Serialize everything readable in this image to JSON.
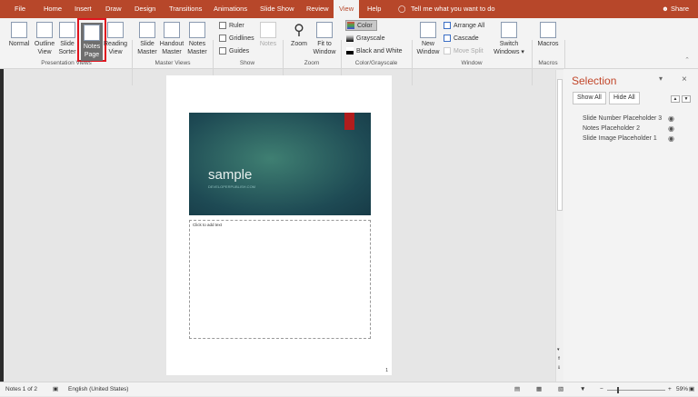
{
  "tabs": [
    "File",
    "Home",
    "Insert",
    "Draw",
    "Design",
    "Transitions",
    "Animations",
    "Slide Show",
    "Review",
    "View",
    "Help"
  ],
  "active_tab": "View",
  "tell_me": "Tell me what you want to do",
  "share": "Share",
  "ribbon": {
    "presentation_views": {
      "label": "Presentation Views",
      "buttons": [
        "Normal",
        "Outline View",
        "Slide Sorter",
        "Notes Page",
        "Reading View"
      ],
      "selected": "Notes Page"
    },
    "master_views": {
      "label": "Master Views",
      "buttons": [
        "Slide Master",
        "Handout Master",
        "Notes Master"
      ]
    },
    "show": {
      "label": "Show",
      "checks": [
        {
          "label": "Ruler",
          "checked": false
        },
        {
          "label": "Gridlines",
          "checked": false
        },
        {
          "label": "Guides",
          "checked": false
        }
      ],
      "notes": "Notes"
    },
    "zoom": {
      "label": "Zoom",
      "buttons": [
        "Zoom",
        "Fit to Window"
      ]
    },
    "color": {
      "label": "Color/Grayscale",
      "buttons": [
        "Color",
        "Grayscale",
        "Black and White"
      ],
      "selected": "Color"
    },
    "window": {
      "label": "Window",
      "new_window": "New Window",
      "arrange_all": "Arrange All",
      "cascade": "Cascade",
      "move_split": "Move Split",
      "switch_windows": "Switch Windows"
    },
    "macros": {
      "label": "Macros",
      "button": "Macros"
    }
  },
  "slide": {
    "title": "sample",
    "subtitle": "DEVELOPERPUBLISH.COM",
    "notes_placeholder": "Click to add text",
    "page_number": "1"
  },
  "selection_pane": {
    "title": "Selection",
    "show_all": "Show All",
    "hide_all": "Hide All",
    "items": [
      "Slide Number Placeholder 3",
      "Notes Placeholder 2",
      "Slide Image Placeholder 1"
    ]
  },
  "status": {
    "page": "Notes 1 of 2",
    "language": "English (United States)",
    "zoom": "59%",
    "zoom_percent": 59
  },
  "colors": {
    "accent": "#b7472a",
    "highlight": "#e0141e"
  }
}
